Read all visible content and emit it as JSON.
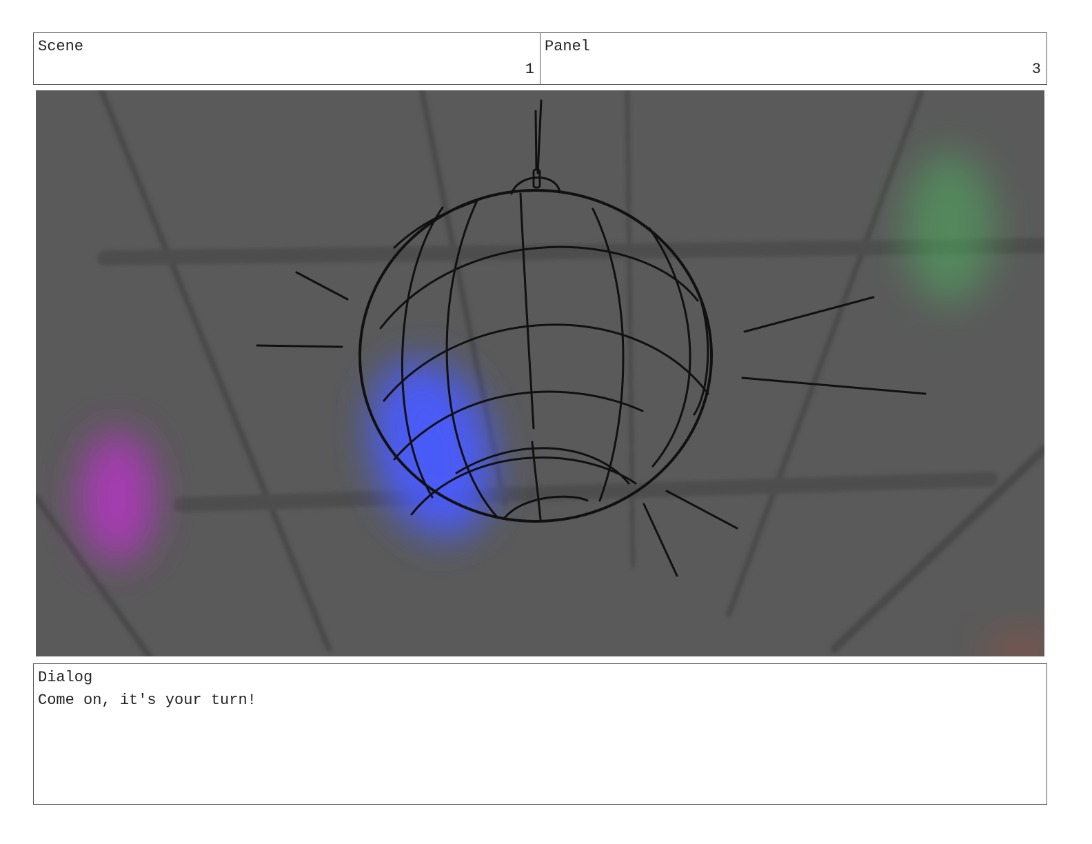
{
  "header": {
    "scene_label": "Scene",
    "scene_number": "1",
    "panel_label": "Panel",
    "panel_number": "3"
  },
  "panel_image": {
    "subject": "disco-ball",
    "background_color": "#5a5a5a",
    "light_colors": {
      "blue": "#4a5cff",
      "green": "#4ec060",
      "magenta": "#c030d0"
    }
  },
  "dialog": {
    "label": "Dialog",
    "text": "Come on, it's your turn!"
  }
}
